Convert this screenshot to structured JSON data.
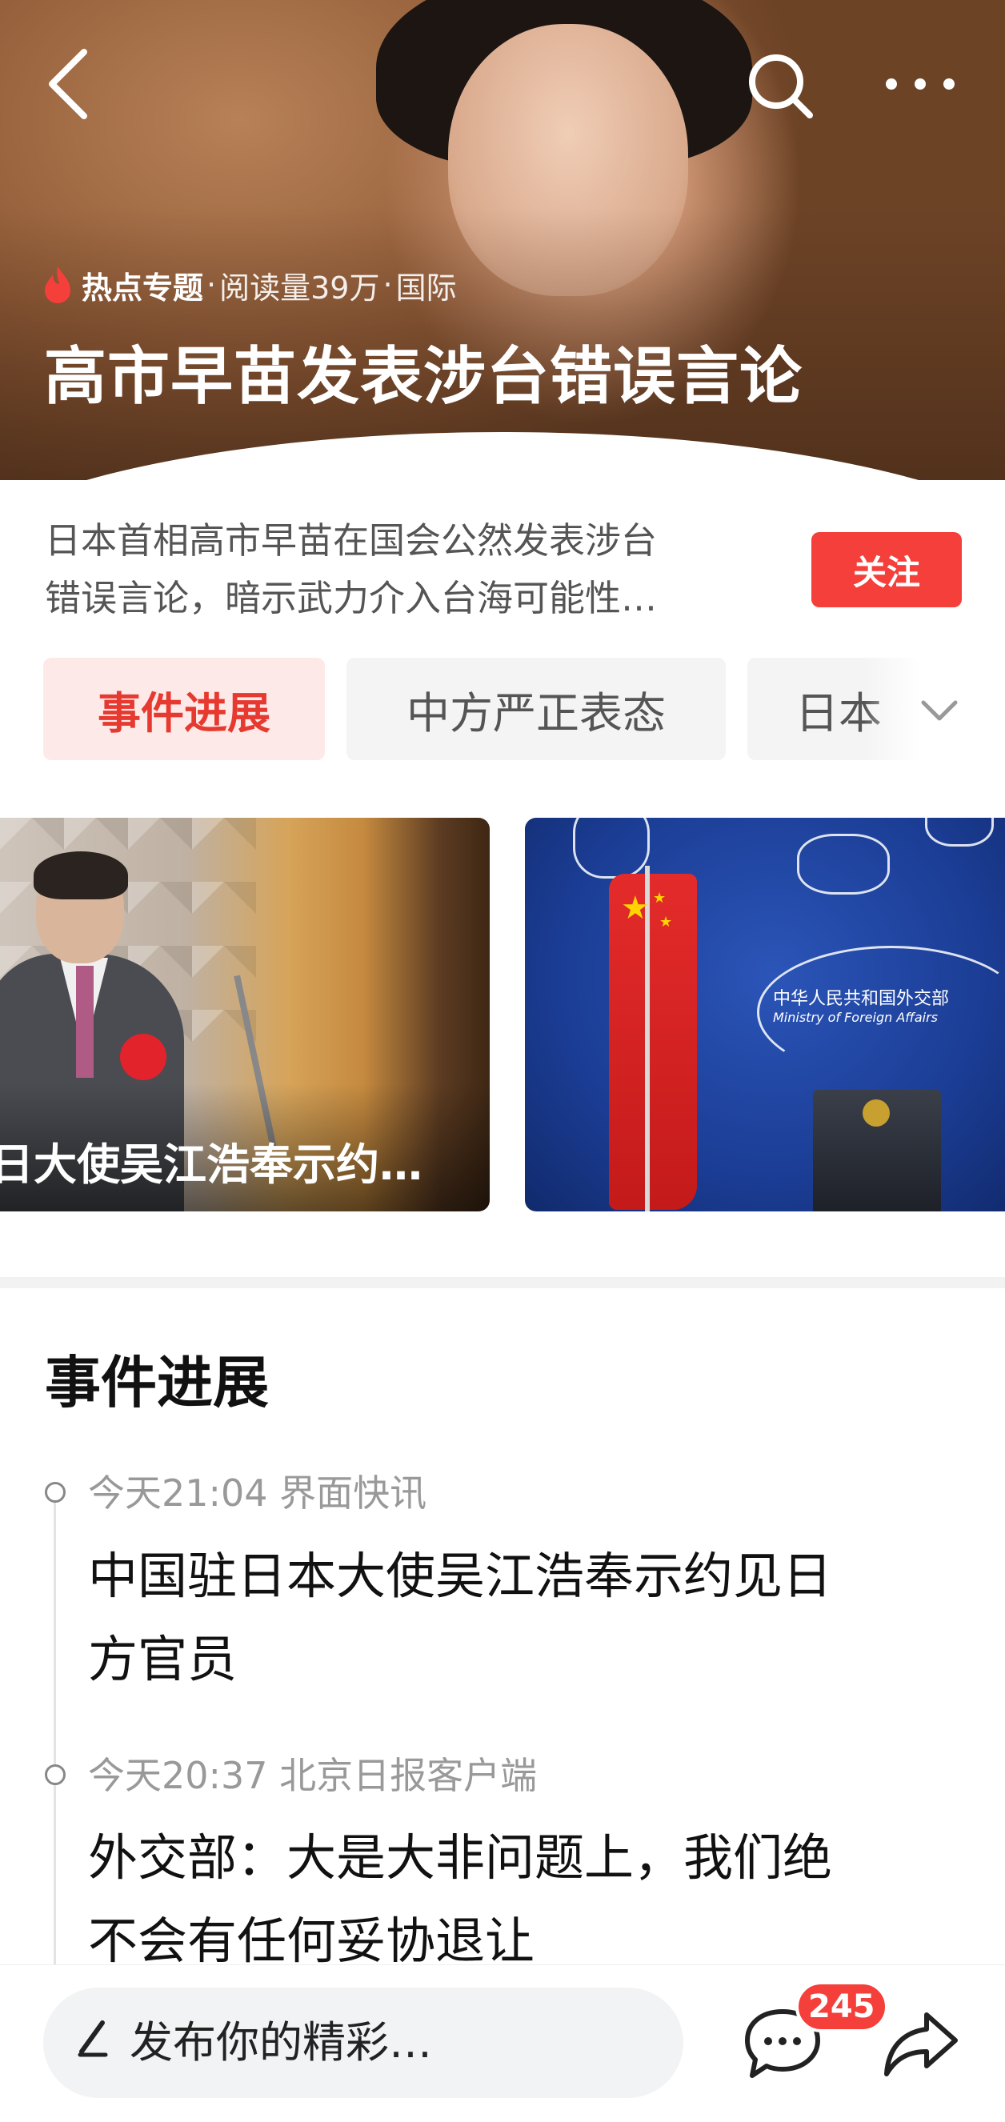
{
  "hero": {
    "tag": "热点专题",
    "reads": "阅读量39万",
    "category": "国际",
    "separator": "·",
    "title": "高市早苗发表涉台错误言论"
  },
  "description": {
    "line1": "日本首相高市早苗在国会公然发表涉台",
    "line2": "错误言论，暗示武力介入台海可能性…"
  },
  "follow_label": "关注",
  "tabs": [
    {
      "label": "事件进展",
      "active": true
    },
    {
      "label": "中方严正表态",
      "active": false
    },
    {
      "label": "日本",
      "active": false
    }
  ],
  "cards": [
    {
      "caption": "日大使吴江浩奉示约…"
    },
    {
      "emblem_cn": "中华人民共和国外交部",
      "emblem_en": "Ministry of Foreign Affairs"
    }
  ],
  "section_title": "事件进展",
  "timeline": [
    {
      "meta": "今天21:04 界面快讯",
      "title_line1": "中国驻日本大使吴江浩奉示约见日",
      "title_line2": "方官员"
    },
    {
      "meta": "今天20:37 北京日报客户端",
      "title_line1": "外交部：大是大非问题上，我们绝",
      "title_line2": "不会有任何妥协退让"
    }
  ],
  "bottom": {
    "placeholder": "发布你的精彩…",
    "comment_count": "245"
  },
  "icons": [
    "back-icon",
    "search-icon",
    "more-icon",
    "flame-icon",
    "chevron-down-icon",
    "pen-icon",
    "chat-icon",
    "share-icon"
  ],
  "colors": {
    "accent": "#f43f3b",
    "tab_active_bg": "#fde9e8",
    "tab_active_text": "#e6392f"
  }
}
